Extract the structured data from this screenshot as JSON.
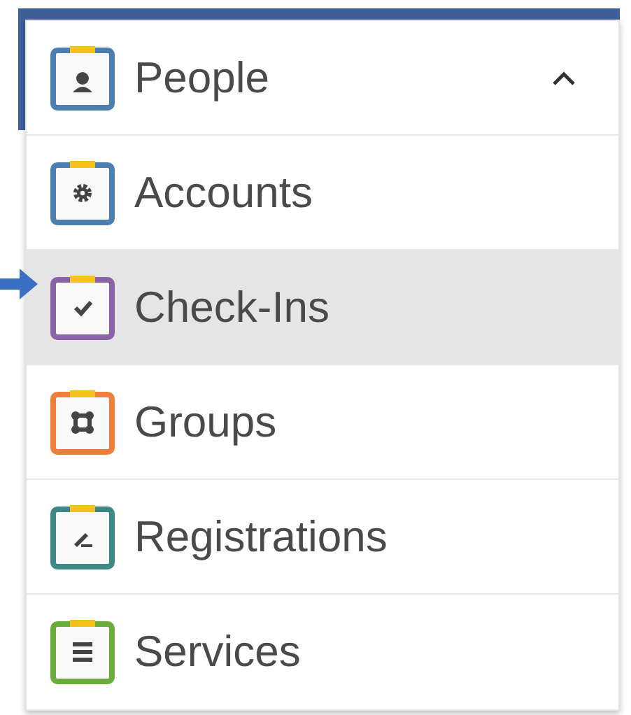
{
  "header": {
    "label": "People",
    "color": "#4a7fb0",
    "expanded": true
  },
  "items": [
    {
      "label": "Accounts",
      "color": "#4a7fb0",
      "selected": false
    },
    {
      "label": "Check-Ins",
      "color": "#8a62a6",
      "selected": true
    },
    {
      "label": "Groups",
      "color": "#ef7d3b",
      "selected": false
    },
    {
      "label": "Registrations",
      "color": "#3d8985",
      "selected": false
    },
    {
      "label": "Services",
      "color": "#6aad3c",
      "selected": false
    }
  ]
}
